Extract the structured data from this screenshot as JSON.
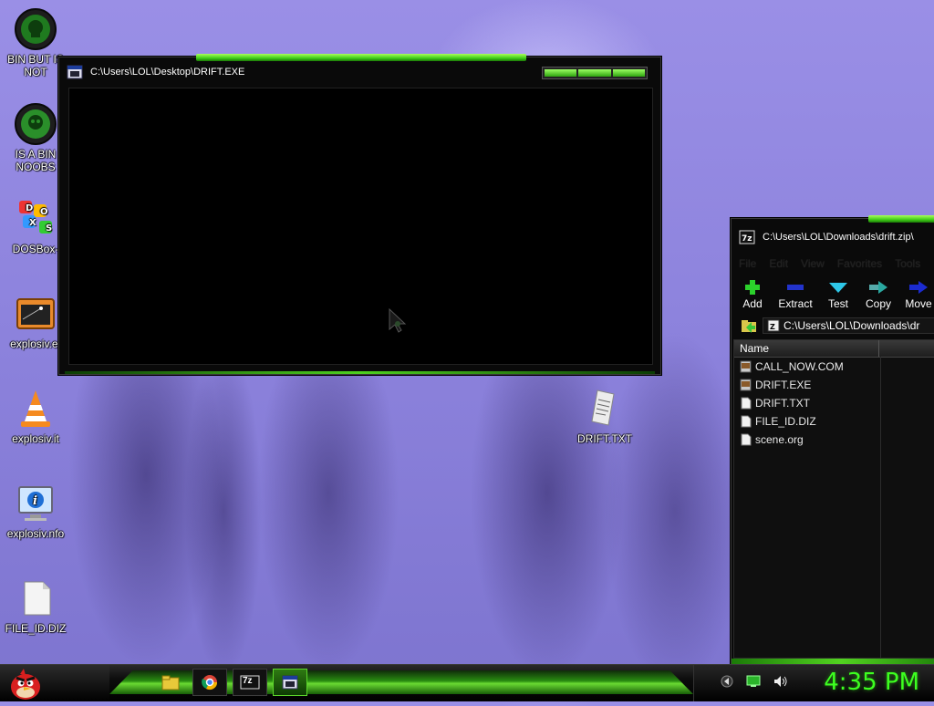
{
  "desktop": {
    "icons": [
      {
        "label": "BIN BUT IS NOT",
        "icon": "bin-skull-icon"
      },
      {
        "label": "IS A BIN NOOBS",
        "icon": "bin-skull-icon"
      },
      {
        "label": "DOSBox-",
        "icon": "dosbox-icon"
      },
      {
        "label": "explosiv.e:",
        "icon": "exe-app-icon"
      },
      {
        "label": "explosiv.it",
        "icon": "vlc-cone-icon"
      },
      {
        "label": "explosiv.nfo",
        "icon": "info-monitor-icon"
      },
      {
        "label": "FILE_ID.DIZ",
        "icon": "text-file-icon"
      },
      {
        "label": "DRIFT.TXT",
        "icon": "text-document-icon"
      }
    ]
  },
  "cmd_window": {
    "title": "C:\\Users\\LOL\\Desktop\\DRIFT.EXE",
    "icon": "dos-window-icon"
  },
  "zip_window": {
    "title": "C:\\Users\\LOL\\Downloads\\drift.zip\\",
    "menu": [
      "File",
      "Edit",
      "View",
      "Favorites",
      "Tools"
    ],
    "toolbar": [
      {
        "label": "Add",
        "icon": "plus-icon",
        "color": "#2bd12b"
      },
      {
        "label": "Extract",
        "icon": "minus-icon",
        "color": "#2233cc"
      },
      {
        "label": "Test",
        "icon": "check-chevron-icon",
        "color": "#2ec7e8"
      },
      {
        "label": "Copy",
        "icon": "double-arrow-icon",
        "color": "#2aa8a0"
      },
      {
        "label": "Move",
        "icon": "arrow-right-icon",
        "color": "#1b2bd0"
      }
    ],
    "address": "C:\\Users\\LOL\\Downloads\\dr",
    "columns": [
      "Name"
    ],
    "files": [
      {
        "name": "CALL_NOW.COM",
        "icon": "exe-file-icon"
      },
      {
        "name": "DRIFT.EXE",
        "icon": "exe-file-icon"
      },
      {
        "name": "DRIFT.TXT",
        "icon": "text-file-icon"
      },
      {
        "name": "FILE_ID.DIZ",
        "icon": "text-file-icon"
      },
      {
        "name": "scene.org",
        "icon": "text-file-icon"
      }
    ]
  },
  "taskbar": {
    "start_icon": "angry-bird-icon",
    "items": [
      {
        "icon": "folder-icon"
      },
      {
        "icon": "chrome-icon"
      },
      {
        "icon": "7zip-icon",
        "label": "7z"
      },
      {
        "icon": "dos-window-icon",
        "active": true
      }
    ],
    "clock": "4:35 PM",
    "tray": [
      "back-arrow-icon",
      "network-icon",
      "speaker-icon"
    ]
  }
}
